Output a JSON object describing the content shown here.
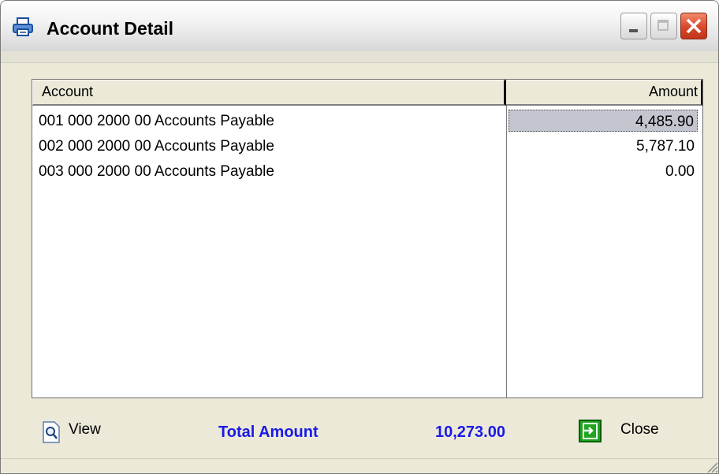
{
  "window": {
    "title": "Account Detail"
  },
  "list": {
    "columns": {
      "account": "Account",
      "amount": "Amount"
    },
    "rows": [
      {
        "account": "001 000 2000 00 Accounts Payable",
        "amount": "4,485.90"
      },
      {
        "account": "002 000 2000 00 Accounts Payable",
        "amount": "5,787.10"
      },
      {
        "account": "003 000 2000 00 Accounts Payable",
        "amount": "0.00"
      }
    ],
    "selected_row": 0
  },
  "footer": {
    "view_label": "View",
    "total_label": "Total Amount",
    "total_value": "10,273.00",
    "close_label": "Close"
  },
  "colors": {
    "total": "#1a1ae6",
    "selection": "#c4c6cf",
    "close_icon": "#1a9a1a"
  },
  "icons": {
    "title": "printer-icon",
    "view": "magnifier-icon",
    "close": "exit-door-icon"
  }
}
